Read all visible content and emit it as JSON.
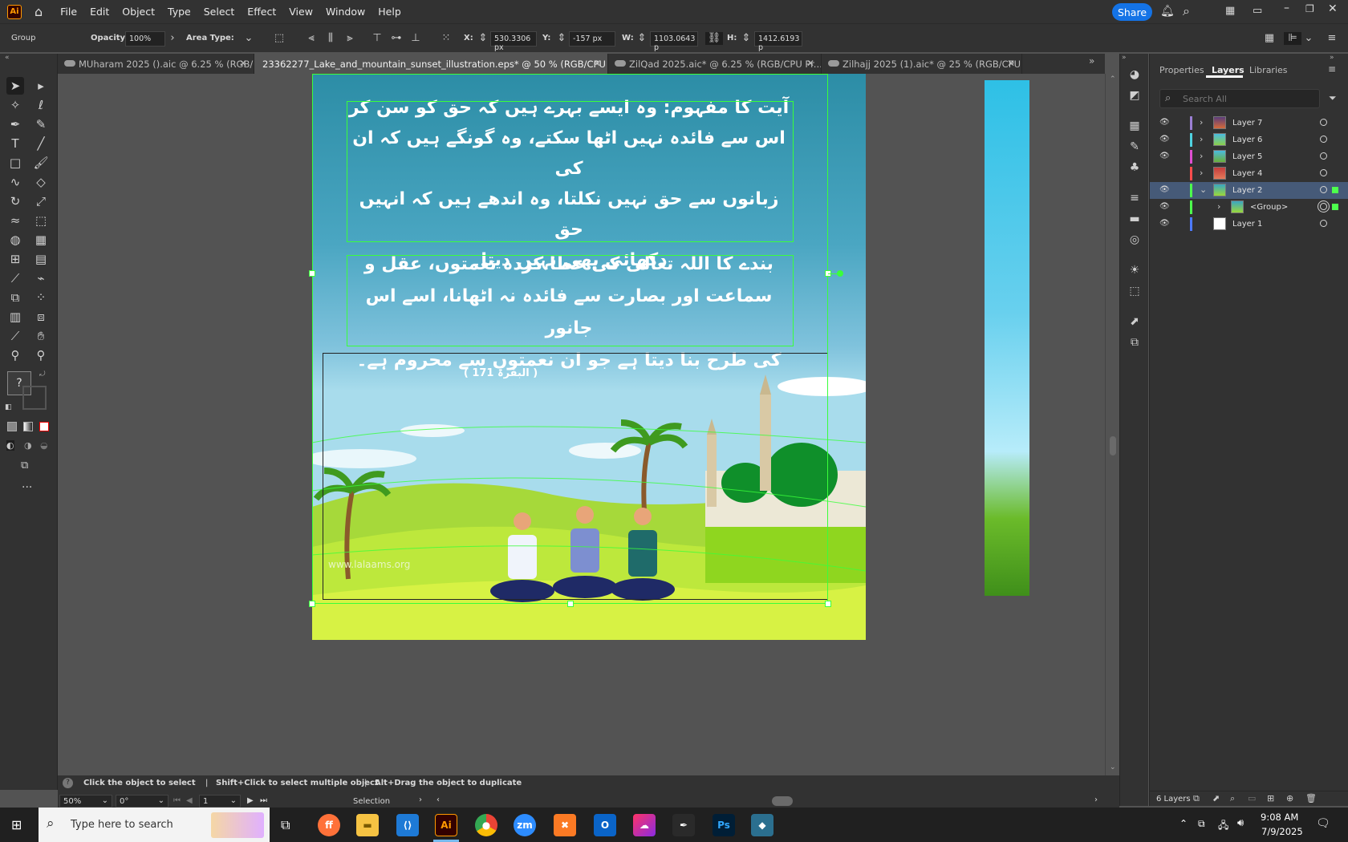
{
  "app": {
    "logo_text": "Ai"
  },
  "menu": [
    "File",
    "Edit",
    "Object",
    "Type",
    "Select",
    "Effect",
    "View",
    "Window",
    "Help"
  ],
  "share_label": "Share",
  "control": {
    "selection_type": "Group",
    "opacity_label": "Opacity:",
    "opacity_value": "100%",
    "area_type_label": "Area Type:",
    "x_label": "X:",
    "x_value": "530.3306 px",
    "y_label": "Y:",
    "y_value": "-157 px",
    "w_label": "W:",
    "w_value": "1103.0643 p",
    "h_label": "H:",
    "h_value": "1412.6193 p"
  },
  "tabs": [
    {
      "label": "MUharam 2025 ().aic @ 6.25 % (RGB/C...",
      "active": false
    },
    {
      "label": "23362277_Lake_and_mountain_sunset_illustration.eps* @ 50 % (RGB/CPU Preview)",
      "active": true
    },
    {
      "label": "ZilQad 2025.aic* @ 6.25 % (RGB/CPU Pr...",
      "active": false
    },
    {
      "label": "Zilhajj 2025 (1).aic* @ 25 % (RGB/CPU ...",
      "active": false
    }
  ],
  "artboard": {
    "para1": [
      "آیت کا مفہوم: وہ ایسے بہرے ہیں کہ حق کو سن کر",
      "اس سے فائدہ نہیں اٹھا سکتے، وہ گونگے ہیں کہ ان کی",
      "زبانوں سے حق نہیں نکلتا، وہ اندھے ہیں کہ انہیں حق",
      "دکھائی بھی نہیں دیتا۔"
    ],
    "para2": [
      "بندے کا اللہ تعالی کی عطا کردہ نعمتوں، عقل و",
      "سماعت اور بصارت سے فائدہ نہ اٹھانا، اسے اس جانور",
      "کی طرح بنا دیتا ہے جو ان نعمتوں سے محروم ہے۔"
    ],
    "reference": "( البقرۃ 171 )",
    "website": "www.lalaams.org"
  },
  "panel": {
    "tabs": [
      "Properties",
      "Layers",
      "Libraries"
    ],
    "active_tab": "Layers",
    "search_placeholder": "Search All",
    "layers": [
      {
        "name": "Layer 7",
        "color": "#9b7fd4",
        "expanded": false
      },
      {
        "name": "Layer 6",
        "color": "#4fd2e0",
        "expanded": false
      },
      {
        "name": "Layer 5",
        "color": "#e04fd2",
        "expanded": false
      },
      {
        "name": "Layer 4",
        "color": "#ff4d4d",
        "expanded": false
      },
      {
        "name": "Layer 2",
        "color": "#4dff4d",
        "expanded": true
      },
      {
        "name": "<Group>",
        "color": "#4dff4d",
        "expanded": false
      },
      {
        "name": "Layer 1",
        "color": "#4d7aff",
        "expanded": false
      }
    ],
    "footer_count": "6 Layers"
  },
  "status": {
    "hint": "Click the object to select",
    "hint2": "Shift+Click to select multiple object",
    "hint3": "Alt+Drag the object to duplicate",
    "zoom": "50%",
    "rotation": "0°",
    "artboard_num": "1",
    "tool_name": "Selection"
  },
  "taskbar": {
    "search_placeholder": "Type here to search",
    "time": "9:08 AM",
    "date": "7/9/2025"
  }
}
